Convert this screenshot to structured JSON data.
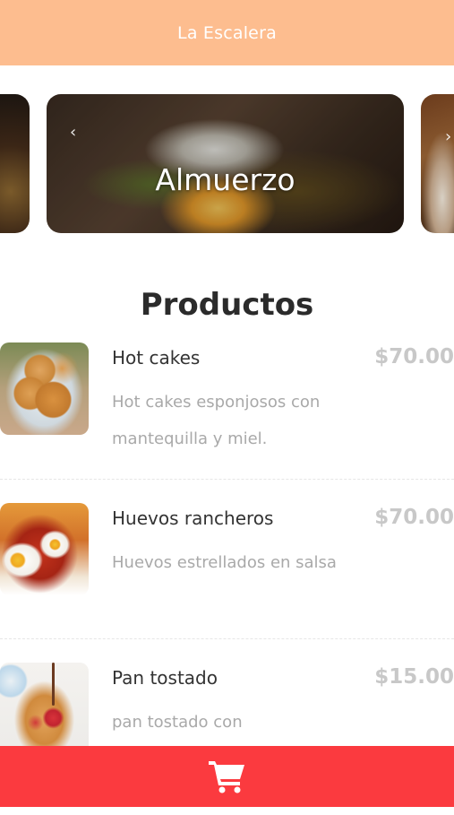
{
  "header": {
    "title": "La Escalera"
  },
  "carousel": {
    "active_label": "Almuerzo",
    "prev_icon": "chevron-left-icon",
    "next_icon": "chevron-right-icon"
  },
  "section": {
    "title": "Productos"
  },
  "products": [
    {
      "name": "Hot cakes",
      "price": "$70.00",
      "description": "Hot cakes esponjosos con mantequilla y miel.",
      "image": "hotcakes-photo"
    },
    {
      "name": "Huevos rancheros",
      "price": "$70.00",
      "description": "Huevos estrellados en salsa",
      "image": "huevos-rancheros-photo"
    },
    {
      "name": "Pan tostado",
      "price": "$15.00",
      "description": "pan tostado con",
      "image": "pan-tostado-photo"
    }
  ],
  "footer": {
    "cart_icon": "shopping-cart-icon"
  },
  "colors": {
    "header_bg": "#fdbd8f",
    "footer_bg": "#fb3a3f",
    "price_text": "#c8c8c8",
    "desc_text": "#a9a9a9"
  }
}
